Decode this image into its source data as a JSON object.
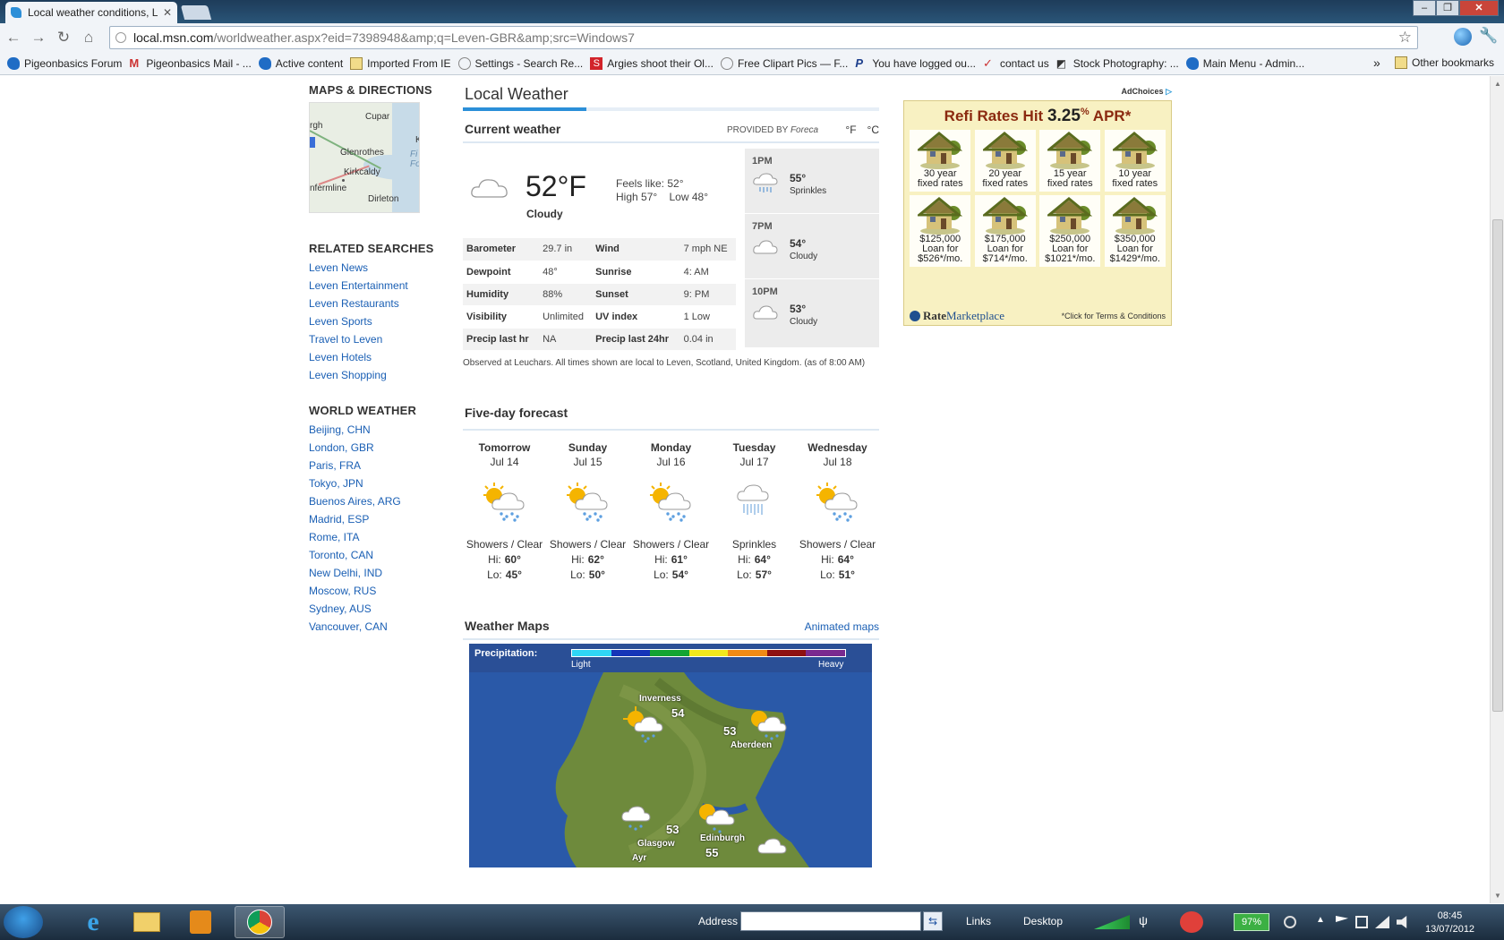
{
  "browser": {
    "tab_title": "Local weather conditions, L",
    "url_host": "local.msn.com",
    "url_rest": "/worldweather.aspx?eid=7398948&amp;q=Leven-GBR&amp;src=Windows7",
    "bookmarks": [
      "Pigeonbasics Forum",
      "Pigeonbasics Mail - ...",
      "Active content",
      "Imported From IE",
      "Settings - Search Re...",
      "Argies shoot their Ol...",
      "Free Clipart Pics — F...",
      "You have logged ou...",
      "contact us",
      "Stock Photography: ...",
      "Main Menu - Admin..."
    ],
    "other_bookmarks": "Other bookmarks"
  },
  "left": {
    "maps_heading": "MAPS & DIRECTIONS",
    "map_towns": [
      "Cupar",
      "Glenrothes",
      "Kirkcaldy",
      "nfermline",
      "Dirleton",
      "rgh",
      "Fi",
      "Fo",
      "K"
    ],
    "related_heading": "RELATED SEARCHES",
    "related": [
      "Leven News",
      "Leven Entertainment",
      "Leven Restaurants",
      "Leven Sports",
      "Travel to Leven",
      "Leven Hotels",
      "Leven Shopping"
    ],
    "world_heading": "WORLD WEATHER",
    "world": [
      "Beijing, CHN",
      "London, GBR",
      "Paris, FRA",
      "Tokyo, JPN",
      "Buenos Aires, ARG",
      "Madrid, ESP",
      "Rome, ITA",
      "Toronto, CAN",
      "New Delhi, IND",
      "Moscow, RUS",
      "Sydney, AUS",
      "Vancouver, CAN"
    ]
  },
  "current": {
    "title": "Local Weather",
    "section": "Current weather",
    "provided_by": "PROVIDED BY",
    "provider": "Foreca",
    "unit_f": "°F",
    "unit_c": "°C",
    "temp": "52°F",
    "condition": "Cloudy",
    "feels_like": "Feels like: 52°",
    "hilo": "High 57°    Low 48°",
    "table": [
      {
        "k1": "Barometer",
        "v1": "29.7 in",
        "k2": "Wind",
        "v2": "7 mph NE"
      },
      {
        "k1": "Dewpoint",
        "v1": "48°",
        "k2": "Sunrise",
        "v2": "4: AM"
      },
      {
        "k1": "Humidity",
        "v1": "88%",
        "k2": "Sunset",
        "v2": "9: PM"
      },
      {
        "k1": "Visibility",
        "v1": "Unlimited",
        "k2": "UV index",
        "v2": "1 Low"
      },
      {
        "k1": "Precip last hr",
        "v1": "NA",
        "k2": "Precip last 24hr",
        "v2": "0.04 in"
      }
    ],
    "hourly": [
      {
        "time": "1PM",
        "temp": "55°",
        "cond": "Sprinkles",
        "icon": "sprinkles-icon"
      },
      {
        "time": "7PM",
        "temp": "54°",
        "cond": "Cloudy",
        "icon": "cloud-icon"
      },
      {
        "time": "10PM",
        "temp": "53°",
        "cond": "Cloudy",
        "icon": "cloud-icon"
      }
    ],
    "observed": "Observed at Leuchars. All times shown are local to Leven, Scotland, United Kingdom. (as of 8:00 AM)"
  },
  "forecast": {
    "title": "Five-day forecast",
    "days": [
      {
        "name": "Tomorrow",
        "date": "Jul 14",
        "cond": "Showers / Clear",
        "hi": "60°",
        "lo": "45°",
        "icon": "sun-showers-icon"
      },
      {
        "name": "Sunday",
        "date": "Jul 15",
        "cond": "Showers / Clear",
        "hi": "62°",
        "lo": "50°",
        "icon": "sun-showers-icon"
      },
      {
        "name": "Monday",
        "date": "Jul 16",
        "cond": "Showers / Clear",
        "hi": "61°",
        "lo": "54°",
        "icon": "sun-showers-icon"
      },
      {
        "name": "Tuesday",
        "date": "Jul 17",
        "cond": "Sprinkles",
        "hi": "64°",
        "lo": "57°",
        "icon": "sprinkles-icon"
      },
      {
        "name": "Wednesday",
        "date": "Jul 18",
        "cond": "Showers / Clear",
        "hi": "64°",
        "lo": "51°",
        "icon": "sun-showers-icon"
      }
    ],
    "hi_label": "Hi:",
    "lo_label": "Lo:"
  },
  "maps": {
    "title": "Weather Maps",
    "animated": "Animated maps",
    "precip_label": "Precipitation:",
    "light": "Light",
    "heavy": "Heavy",
    "scale_colors": [
      "#2fd6f5",
      "#1534b8",
      "#12a432",
      "#f2e81c",
      "#f08a16",
      "#8e1010",
      "#7a2a8f"
    ],
    "cities": [
      {
        "name": "Inverness",
        "temp": "54"
      },
      {
        "name": "Aberdeen",
        "temp": "53"
      },
      {
        "name": "Glasgow",
        "temp": "53"
      },
      {
        "name": "Edinburgh",
        "temp": "55"
      },
      {
        "name": "Ayr",
        "temp": ""
      }
    ]
  },
  "ad": {
    "adchoices": "AdChoices",
    "title_pre": "Refi Rates Hit",
    "title_rate": "3.25",
    "title_pct": "%",
    "title_post": "APR*",
    "row1": [
      {
        "l1": "30 year",
        "l2": "fixed rates"
      },
      {
        "l1": "20 year",
        "l2": "fixed rates"
      },
      {
        "l1": "15 year",
        "l2": "fixed rates"
      },
      {
        "l1": "10 year",
        "l2": "fixed rates"
      }
    ],
    "row2": [
      {
        "l1": "$125,000",
        "l2": "Loan for",
        "l3": "$526*/mo."
      },
      {
        "l1": "$175,000",
        "l2": "Loan for",
        "l3": "$714*/mo."
      },
      {
        "l1": "$250,000",
        "l2": "Loan for",
        "l3": "$1021*/mo."
      },
      {
        "l1": "$350,000",
        "l2": "Loan for",
        "l3": "$1429*/mo."
      }
    ],
    "logo_a": "Rate",
    "logo_b": "Marketplace",
    "terms": "*Click for Terms & Conditions"
  },
  "taskbar": {
    "address_label": "Address",
    "links": "Links",
    "desktop": "Desktop",
    "battery": "97%",
    "time": "08:45",
    "date": "13/07/2012"
  }
}
